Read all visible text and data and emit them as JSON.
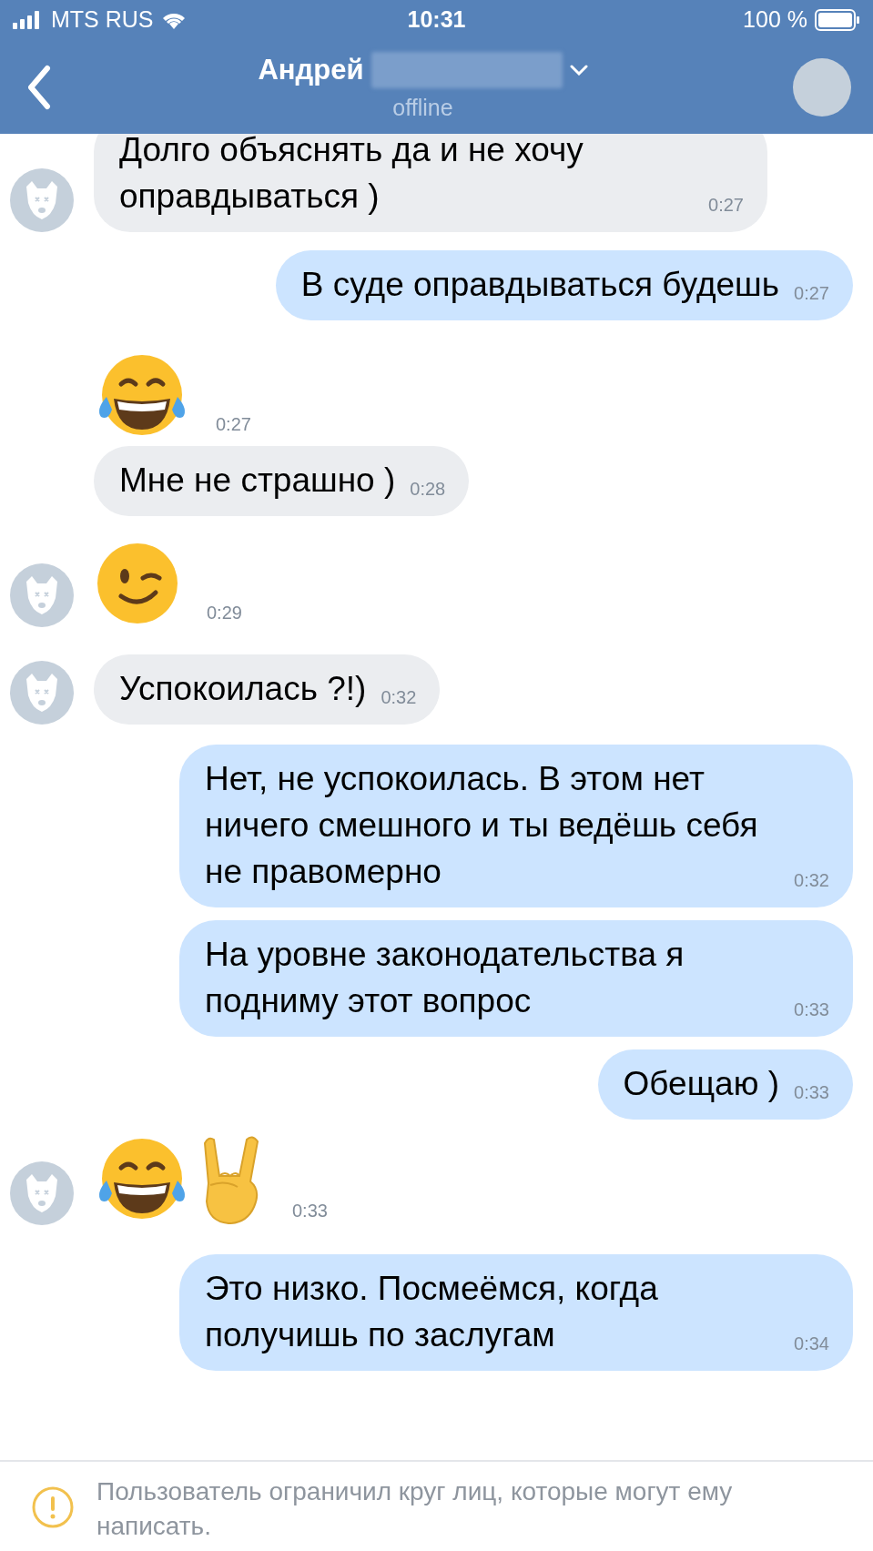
{
  "status_bar": {
    "carrier": "MTS RUS",
    "time": "10:31",
    "battery": "100 %"
  },
  "header": {
    "name": "Андрей",
    "status": "offline"
  },
  "messages": [
    {
      "kind": "incoming",
      "avatar": true,
      "text": "Долго объяснять да и не хочу оправдываться )",
      "time": "0:27"
    },
    {
      "kind": "outgoing",
      "avatar": false,
      "text": "В суде оправдываться будешь",
      "time": "0:27"
    },
    {
      "kind": "emoji",
      "avatar": false,
      "emoji": [
        {
          "kind": "laughing"
        }
      ],
      "time": "0:27"
    },
    {
      "kind": "incoming",
      "avatar": false,
      "text": "Мне не страшно )",
      "time": "0:28"
    },
    {
      "kind": "emoji",
      "avatar": true,
      "emoji": [
        {
          "kind": "winking"
        }
      ],
      "time": "0:29"
    },
    {
      "kind": "incoming",
      "avatar": true,
      "text": "Успокоилась ?!)",
      "time": "0:32"
    },
    {
      "kind": "outgoing",
      "avatar": false,
      "text": "Нет, не успокоилась. В этом нет ничего смешного и ты ведёшь себя не правомерно",
      "time": "0:32"
    },
    {
      "kind": "outgoing",
      "avatar": false,
      "text": "На уровне законодательства я подниму этот вопрос",
      "time": "0:33"
    },
    {
      "kind": "outgoing",
      "avatar": false,
      "text": "Обещаю )",
      "time": "0:33"
    },
    {
      "kind": "emoji",
      "avatar": true,
      "emoji": [
        {
          "kind": "laughing"
        },
        {
          "kind": "horns"
        }
      ],
      "time": "0:33"
    },
    {
      "kind": "outgoing",
      "avatar": false,
      "text": "Это низко. Посмеёмся, когда получишь по заслугам",
      "time": "0:34"
    }
  ],
  "footer": {
    "notice": "Пользователь ограничил круг лиц, которые могут ему написать."
  }
}
